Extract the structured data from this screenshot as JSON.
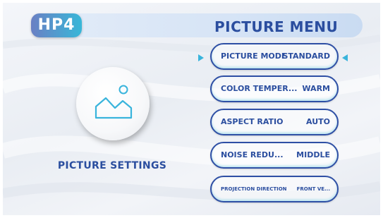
{
  "header": {
    "logo_text": "HP4",
    "title": "PICTURE MENU"
  },
  "left_panel": {
    "icon": "picture-icon",
    "label": "PICTURE SETTINGS"
  },
  "menu": {
    "items": [
      {
        "label": "PICTURE MODE",
        "value": "STANDARD",
        "selected": true
      },
      {
        "label": "COLOR TEMPER...",
        "value": "WARM",
        "selected": false
      },
      {
        "label": "ASPECT RATIO",
        "value": "AUTO",
        "selected": false
      },
      {
        "label": "NOISE REDU...",
        "value": "MIDDLE",
        "selected": false
      },
      {
        "label": "PROJECTION DIRECTION",
        "value": "FRONT VE...",
        "selected": false
      }
    ]
  },
  "colors": {
    "primary_text": "#2b4e9f",
    "accent": "#39b4dc",
    "logo_gradient_start": "#6a80c4",
    "logo_gradient_end": "#38b7d8"
  }
}
